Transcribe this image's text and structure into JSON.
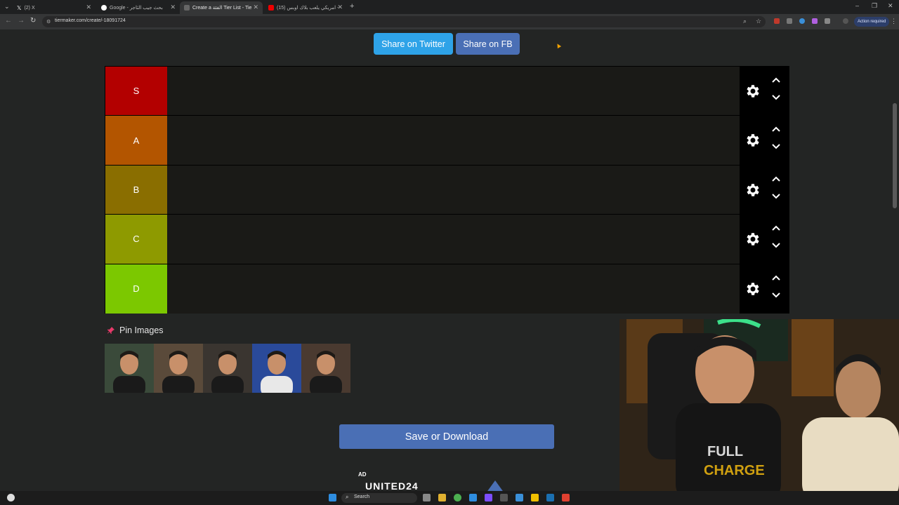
{
  "browser": {
    "tabs": [
      {
        "title": "(2) X",
        "active": false
      },
      {
        "title": "Google - بحث جيب الثاجر",
        "active": false
      },
      {
        "title": "Create a الفئة Tier List - TierMa",
        "active": true
      },
      {
        "title": "(15) امريكي يلعب بلاك اوبس -",
        "active": false
      }
    ],
    "url": "tiermaker.com/create/-18091724",
    "action_required": "Action required"
  },
  "share": {
    "twitter_label": "Share on Twitter",
    "fb_label": "Share on FB"
  },
  "tiers": [
    {
      "label": "S",
      "color": "#b30000"
    },
    {
      "label": "A",
      "color": "#b35500"
    },
    {
      "label": "B",
      "color": "#8a6e00"
    },
    {
      "label": "C",
      "color": "#8e9a00"
    },
    {
      "label": "D",
      "color": "#7cc800"
    }
  ],
  "pinned": {
    "title": "Pin Images",
    "images": [
      {
        "icon": "person-photo-icon",
        "bg": "#3a4a3a"
      },
      {
        "icon": "person-photo-icon",
        "bg": "#5a4a3a"
      },
      {
        "icon": "person-photo-icon",
        "bg": "#3a3530"
      },
      {
        "icon": "person-photo-icon",
        "bg": "#2a4a9a"
      },
      {
        "icon": "person-photo-icon",
        "bg": "#4a3a30"
      }
    ]
  },
  "save_label": "Save or Download",
  "ad": {
    "label": "AD",
    "text": "UNITED24"
  },
  "taskbar": {
    "search_label": "Search"
  },
  "colors": {
    "twitter": "#2ea3e8",
    "facebook": "#4a6fb5",
    "page_bg": "#232524",
    "tier_bg": "#1a1a17"
  }
}
